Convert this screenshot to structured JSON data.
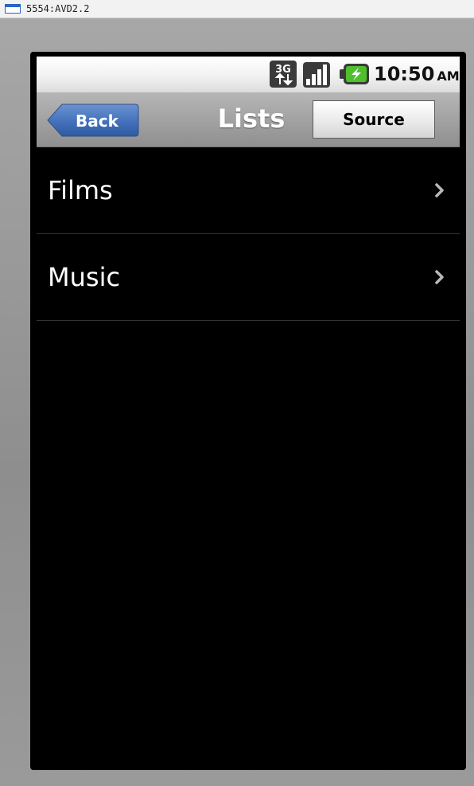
{
  "window": {
    "title": "5554:AVD2.2",
    "icon": "window-icon"
  },
  "statusbar": {
    "icons": [
      "3g-icon",
      "signal-icon",
      "battery-icon"
    ],
    "time": "10:50",
    "ampm": "AM"
  },
  "navbar": {
    "back_label": "Back",
    "title": "Lists",
    "source_label": "Source",
    "colors": {
      "back": "#3f6db3",
      "bar_top": "#b6b6b6",
      "bar_bottom": "#8f8f8f"
    }
  },
  "list": {
    "items": [
      {
        "label": "Films",
        "icon": "chevron-right-icon"
      },
      {
        "label": "Music",
        "icon": "chevron-right-icon"
      }
    ]
  }
}
